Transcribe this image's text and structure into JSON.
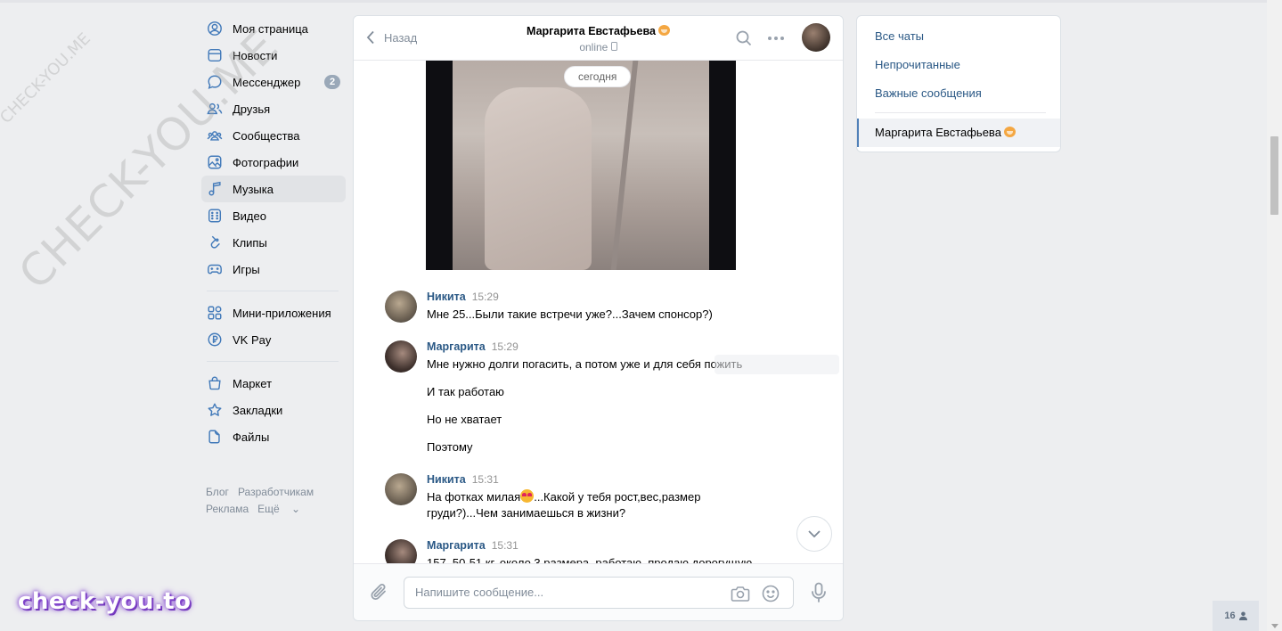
{
  "sidebar": {
    "items": [
      {
        "label": "Моя страница",
        "icon": "user-circle-icon"
      },
      {
        "label": "Новости",
        "icon": "news-icon"
      },
      {
        "label": "Мессенджер",
        "icon": "message-icon",
        "badge": "2"
      },
      {
        "label": "Друзья",
        "icon": "friends-icon"
      },
      {
        "label": "Сообщества",
        "icon": "communities-icon"
      },
      {
        "label": "Фотографии",
        "icon": "photo-icon"
      },
      {
        "label": "Музыка",
        "icon": "music-icon",
        "active": true
      },
      {
        "label": "Видео",
        "icon": "video-icon"
      },
      {
        "label": "Клипы",
        "icon": "clips-icon"
      },
      {
        "label": "Игры",
        "icon": "gamepad-icon"
      }
    ],
    "items2": [
      {
        "label": "Мини-приложения",
        "icon": "apps-icon"
      },
      {
        "label": "VK Pay",
        "icon": "vkpay-icon"
      }
    ],
    "items3": [
      {
        "label": "Маркет",
        "icon": "market-icon"
      },
      {
        "label": "Закладки",
        "icon": "star-icon"
      },
      {
        "label": "Файлы",
        "icon": "file-icon"
      }
    ],
    "footer": {
      "blog": "Блог",
      "dev": "Разработчикам",
      "ads": "Реклама",
      "more": "Ещё"
    }
  },
  "chat": {
    "back_label": "Назад",
    "peer_name": "Маргарита Евстафьева",
    "peer_status": "online",
    "date_pill": "сегодня",
    "messages": [
      {
        "author": "Никита",
        "time": "15:29",
        "lines": [
          "Мне 25...Были такие встречи уже?...Зачем спонсор?)"
        ]
      },
      {
        "author": "Маргарита",
        "time": "15:29",
        "lines": [
          "Мне нужно долги погасить, а потом уже и для себя пожить",
          "И так работаю",
          "Но не хватает",
          "Поэтому"
        ]
      },
      {
        "author": "Никита",
        "time": "15:31",
        "line1a": "На фотках милая",
        "line1b": "...Какой у тебя рост,вес,размер",
        "line2": "груди?)...Чем занимаешься в жизни?"
      },
      {
        "author": "Маргарита",
        "time": "15:31",
        "lines": [
          "157, 50-51 кг, около 3 размера, работаю, продаю дорогущую"
        ]
      }
    ],
    "composer_placeholder": "Напишите сообщение..."
  },
  "right_panel": {
    "filters": [
      "Все чаты",
      "Непрочитанные",
      "Важные сообщения"
    ],
    "conversation": "Маргарита Евстафьева"
  },
  "online_count": "16",
  "watermarks": {
    "small": "CHECK-YOU.ME",
    "large": "CHECK-YOU.ME",
    "brand": "check-you.to"
  },
  "colors": {
    "link": "#2a5885",
    "accent": "#5181b8",
    "icon": "#447bba",
    "background": "#edeef0"
  }
}
